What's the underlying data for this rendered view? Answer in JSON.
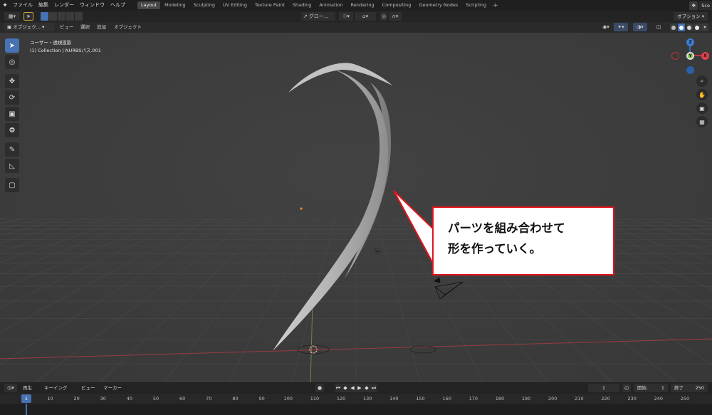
{
  "topbar": {
    "menus": [
      "ファイル",
      "編集",
      "レンダー",
      "ウィンドウ",
      "ヘルプ"
    ],
    "workspaces": [
      "Layout",
      "Modeling",
      "Sculpting",
      "UV Editing",
      "Texture Paint",
      "Shading",
      "Animation",
      "Rendering",
      "Compositing",
      "Geometry Nodes",
      "Scripting"
    ],
    "active_workspace": "Layout",
    "add_label": "+",
    "scene_label": "Sce"
  },
  "header": {
    "transform_label": "グロー...",
    "options_label": "オプション"
  },
  "viewport_header": {
    "mode": "オブジェク...",
    "menus": [
      "ビュー",
      "選択",
      "追加",
      "オブジェクト"
    ]
  },
  "viewport": {
    "view_name": "ユーザー・透視投影",
    "collection_info": "(1) Collection | NURBSパス.001",
    "axis_x": "X",
    "axis_y": "Y",
    "axis_z": "Z"
  },
  "callout": {
    "line1": "パーツを組み合わせて",
    "line2": "形を作っていく。",
    "border_color": "#e4141b"
  },
  "timeline": {
    "menus": [
      "再生",
      "キーイング",
      "ビュー",
      "マーカー"
    ],
    "current_frame": "1",
    "start_label": "開始",
    "start_value": "1",
    "end_label": "終了",
    "end_value": "250",
    "ruler_labels": [
      "1",
      "10",
      "20",
      "30",
      "40",
      "50",
      "60",
      "70",
      "80",
      "90",
      "100",
      "110",
      "120",
      "130",
      "140",
      "150",
      "160",
      "170",
      "180",
      "190",
      "200",
      "210",
      "220",
      "230",
      "240",
      "250"
    ]
  },
  "colors": {
    "accent": "#4772b3",
    "viewport_bg": "#3d3d3d",
    "x_axis": "#e0404e",
    "y_axis": "#7fbf3f",
    "z_axis": "#3a7fd4"
  }
}
